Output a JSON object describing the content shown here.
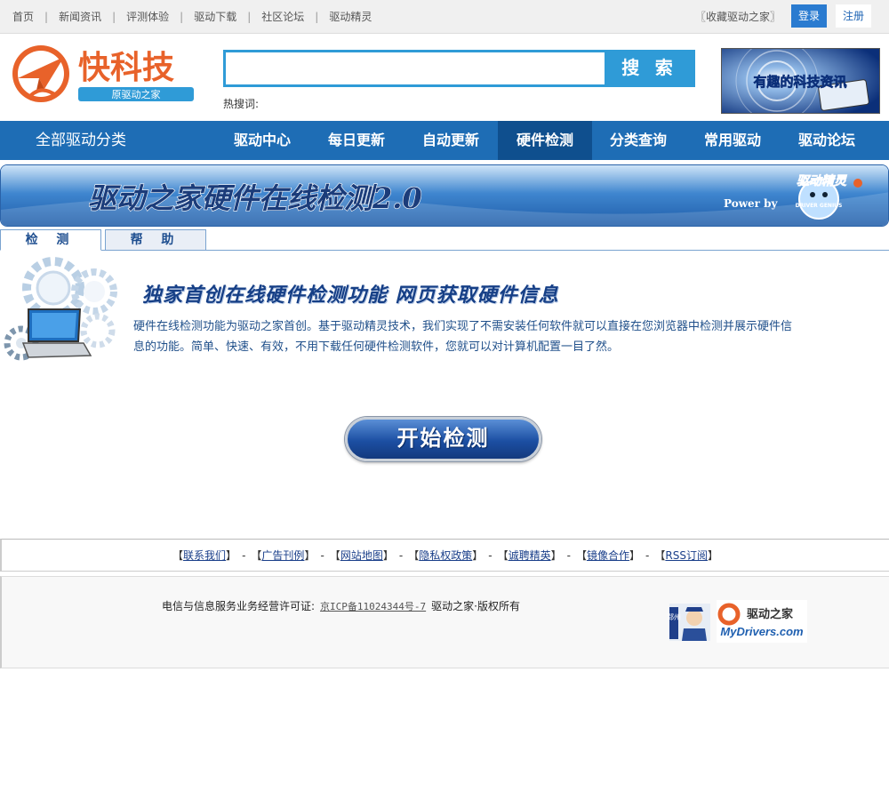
{
  "topbar": {
    "nav": [
      "首页",
      "新闻资讯",
      "评测体验",
      "驱动下载",
      "社区论坛",
      "驱动精灵"
    ],
    "favorite": "〖收藏驱动之家〗",
    "login": "登录",
    "register": "注册"
  },
  "header": {
    "logo_text": "快科技",
    "logo_sub": "原驱动之家",
    "search_button": "搜 索",
    "search_value": "",
    "hotwords_label": "热搜词:",
    "ad_text": "有趣的科技资讯"
  },
  "mainnav": {
    "all_categories": "全部驱动分类",
    "items": [
      "驱动中心",
      "每日更新",
      "自动更新",
      "硬件检测",
      "分类查询",
      "常用驱动",
      "驱动论坛"
    ],
    "active": "硬件检测"
  },
  "banner": {
    "title": "驱动之家硬件在线检测2.0",
    "power_by": "Power by",
    "brand": "驱动精灵",
    "brand_en": "DRIVER GENIUS"
  },
  "tabs": [
    "检 测",
    "帮 助"
  ],
  "content": {
    "title": "独家首创在线硬件检测功能  网页获取硬件信息",
    "description": "硬件在线检测功能为驱动之家首创。基于驱动精灵技术，我们实现了不需安装任何软件就可以直接在您浏览器中检测并展示硬件信息的功能。简单、快速、有效，不用下载任何硬件检测软件，您就可以对计算机配置一目了然。",
    "start_button": "开始检测"
  },
  "footer": {
    "links": [
      "联系我们",
      "广告刊例",
      "网站地图",
      "隐私权政策",
      "诚聘精英",
      "镜像合作",
      "RSS订阅"
    ],
    "license_label": "电信与信息服务业务经营许可证:",
    "icp": "京ICP备11024344号-7",
    "copyright": "驱动之家·版权所有",
    "police_text": "郑州",
    "mydrivers_cn": "驱动之家",
    "mydrivers_en": "MyDrivers.com"
  },
  "colors": {
    "nav_blue": "#1e6db5",
    "nav_active": "#0f4f8e",
    "search_blue": "#2f9bd7",
    "logo_orange": "#e8622a"
  }
}
